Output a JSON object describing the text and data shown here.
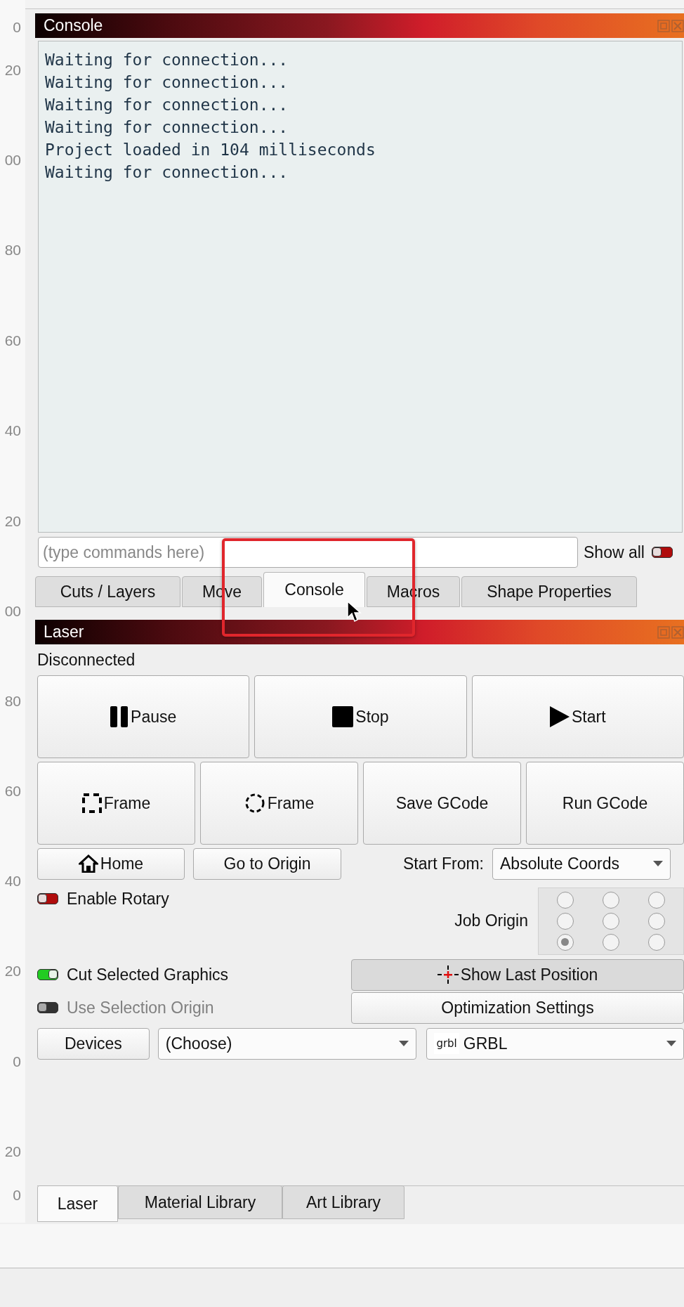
{
  "ruler": {
    "labels": [
      "0",
      "20",
      "00",
      "80",
      "60",
      "40",
      "20",
      "00",
      "80",
      "60",
      "40",
      "20",
      "0",
      "20",
      "0"
    ]
  },
  "console": {
    "title": "Console",
    "lines": [
      "Waiting for connection...",
      "Waiting for connection...",
      "Waiting for connection...",
      "Waiting for connection...",
      "Project loaded in 104 milliseconds",
      "Waiting for connection..."
    ],
    "command_field": {
      "placeholder": "(type commands here)"
    },
    "show_all": {
      "label": "Show all",
      "on": false
    },
    "tabs": [
      {
        "label": "Cuts / Layers",
        "selected": false
      },
      {
        "label": "Move",
        "selected": false
      },
      {
        "label": "Console",
        "selected": true
      },
      {
        "label": "Macros",
        "selected": false
      },
      {
        "label": "Shape Properties",
        "selected": false
      }
    ]
  },
  "laser": {
    "title": "Laser",
    "status": "Disconnected",
    "main_buttons": [
      "Pause",
      "Stop",
      "Start"
    ],
    "frame_buttons": [
      "Frame",
      "Frame",
      "Save GCode",
      "Run GCode"
    ],
    "home_button": "Home",
    "origin_button": "Go to Origin",
    "start_from": {
      "label": "Start From:",
      "value": "Absolute Coords"
    },
    "enable_rotary": {
      "label": "Enable Rotary",
      "on": false,
      "disabled": false
    },
    "job_origin": {
      "label": "Job Origin",
      "positions": [
        {
          "selected": false
        },
        {
          "selected": false
        },
        {
          "selected": false
        },
        {
          "selected": false
        },
        {
          "selected": false
        },
        {
          "selected": false
        },
        {
          "selected": true
        },
        {
          "selected": false
        },
        {
          "selected": false
        }
      ]
    },
    "cut_selected_graphics": {
      "label": "Cut Selected Graphics",
      "on": true,
      "disabled": false
    },
    "show_last_position": {
      "label": "Show Last Position",
      "pressed": true
    },
    "use_selection_origin": {
      "label": "Use Selection Origin",
      "on": false,
      "disabled": true
    },
    "optimization_button": "Optimization Settings",
    "devices_button": "Devices",
    "device": {
      "value": "(Choose)"
    },
    "controller": {
      "logo": "grbl",
      "value": "GRBL"
    }
  },
  "bottom_tabs": [
    {
      "label": "Laser",
      "selected": true
    },
    {
      "label": "Material Library",
      "selected": false
    },
    {
      "label": "Art Library",
      "selected": false
    }
  ]
}
